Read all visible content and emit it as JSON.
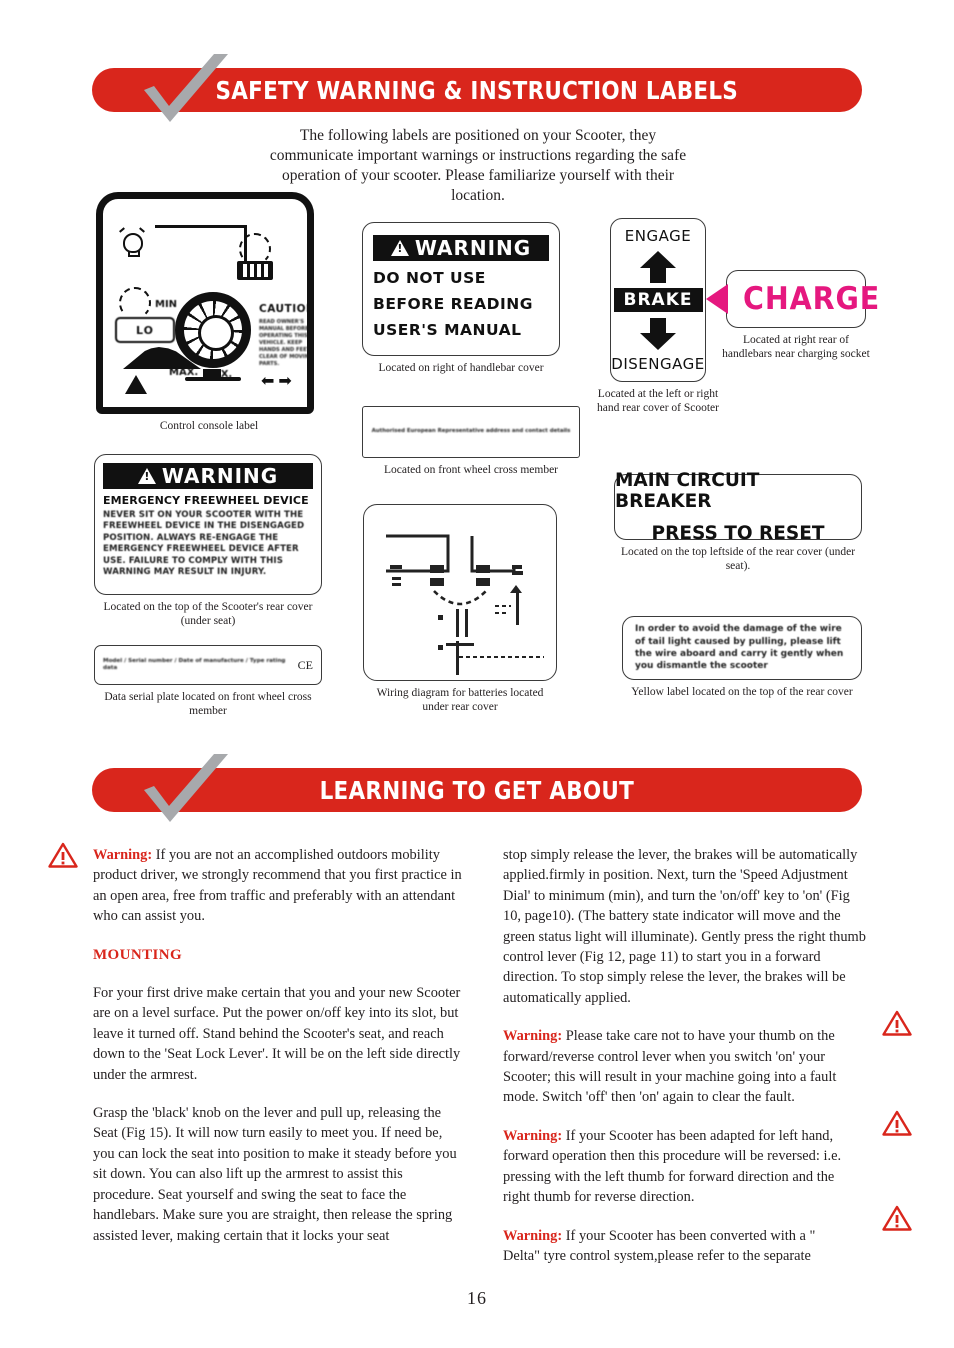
{
  "page": {
    "number": "16",
    "accent_red": "#d9261c",
    "charge_pink": "#e5187f"
  },
  "sections": [
    {
      "id": "safety",
      "title": "SAFETY WARNING & INSTRUCTION LABELS"
    },
    {
      "id": "learning",
      "title": "LEARNING TO GET ABOUT"
    }
  ],
  "intro": "The following labels are positioned on your Scooter, they communicate important warnings or instructions regarding the safe operation of your scooter. Please familiarize yourself with their location.",
  "labels": {
    "console": {
      "caption": "Control console label",
      "lo": "LO",
      "min": "MIN",
      "max_left": "MAX.",
      "max_right": "MAX.",
      "caution_title": "CAUTION",
      "caution_body": "READ OWNER'S MANUAL BEFORE OPERATING THIS VEHICLE. KEEP HANDS AND FEET CLEAR OF MOVING PARTS."
    },
    "do_not_use": {
      "header": "WARNING",
      "line1": "DO NOT USE",
      "line2": "BEFORE READING",
      "line3": "USER'S MANUAL",
      "caption": "Located on right of handlebar cover"
    },
    "engage_brake": {
      "top": "ENGAGE",
      "middle": "BRAKE",
      "bottom": "DISENGAGE",
      "caption": "Located at the left or right hand rear cover of Scooter"
    },
    "charge": {
      "text": "CHARGE",
      "caption": "Located at right rear of handlebars near charging socket"
    },
    "freewheel": {
      "header": "WARNING",
      "title": "EMERGENCY FREEWHEEL DEVICE",
      "body": "NEVER SIT ON YOUR SCOOTER WITH THE FREEWHEEL DEVICE IN THE DISENGAGED POSITION. ALWAYS RE-ENGAGE THE EMERGENCY FREEWHEEL DEVICE AFTER USE. FAILURE TO COMPLY WITH THIS WARNING MAY RESULT IN INJURY.",
      "caption": "Located on the top of the Scooter's rear cover (under seat)"
    },
    "front_cross_member": {
      "body": "Authorised European Representative address and contact details",
      "caption": "Located on front wheel cross member"
    },
    "data_plate": {
      "body": "Model / Serial number / Date of manufacture / Type rating data",
      "ce": "CE",
      "caption": "Data serial plate located on front wheel cross member"
    },
    "wiring": {
      "caption": "Wiring diagram for batteries located under rear cover"
    },
    "circuit_breaker": {
      "line1": "MAIN CIRCUIT BREAKER",
      "line2": "PRESS TO RESET",
      "caption": "Located on the top leftside of the rear cover (under seat)."
    },
    "tail_light": {
      "body": "In order to avoid the damage of the wire of tail light caused by pulling, please lift the wire aboard and carry it gently when you dismantle the scooter",
      "caption": "Yellow label located on the top of the rear cover"
    }
  },
  "learning": {
    "left_column": {
      "warning_label": "Warning:",
      "warning_text": " If you are not an accomplished outdoors mobility product driver, we strongly recommend that you first practice in an open area, free from traffic and preferably with an attendant who can assist you.",
      "subhead": "MOUNTING",
      "para1": "For your first drive make certain that you and your new Scooter are on a level surface. Put the power on/off key into its slot, but leave it turned off. Stand behind the Scooter's seat, and reach down to the 'Seat Lock Lever'. It will be on the left side directly under the armrest.",
      "para2": "Grasp the 'black' knob on the lever and pull up, releasing the Seat (Fig 15). It will now turn easily to meet you. If need be, you can lock the seat into position to make it steady before you sit down. You can also lift up the armrest to assist this procedure. Seat yourself and swing the seat to face the handlebars. Make sure you are straight, then release the spring assisted lever, making certain that it locks your seat"
    },
    "right_column": {
      "para1": "stop simply release the lever, the brakes will be automatically applied.firmly in position. Next, turn the 'Speed Adjustment Dial' to minimum (min), and turn the 'on/off' key to 'on' (Fig 10, page10). (The battery state indicator will move and the green status light will illuminate). Gently press the right thumb control lever (Fig 12, page 11) to start you in a forward direction. To stop simply relese the lever, the brakes will be automatically applied.",
      "warning1_label": "Warning:",
      "warning1_text": " Please take care not to have your thumb on the forward/reverse control lever when you switch 'on' your Scooter; this will result in your machine going into a fault mode. Switch 'off' then 'on' again to clear the fault.",
      "warning2_label": "Warning:",
      "warning2_text": " If your Scooter has been adapted for left hand, forward operation then this procedure will be reversed: i.e. pressing with the left thumb for forward direction and the right thumb for reverse direction.",
      "warning3_label": "Warning:",
      "warning3_text": " If your Scooter has been converted with a \" Delta\" tyre control system,please refer to the separate"
    }
  }
}
